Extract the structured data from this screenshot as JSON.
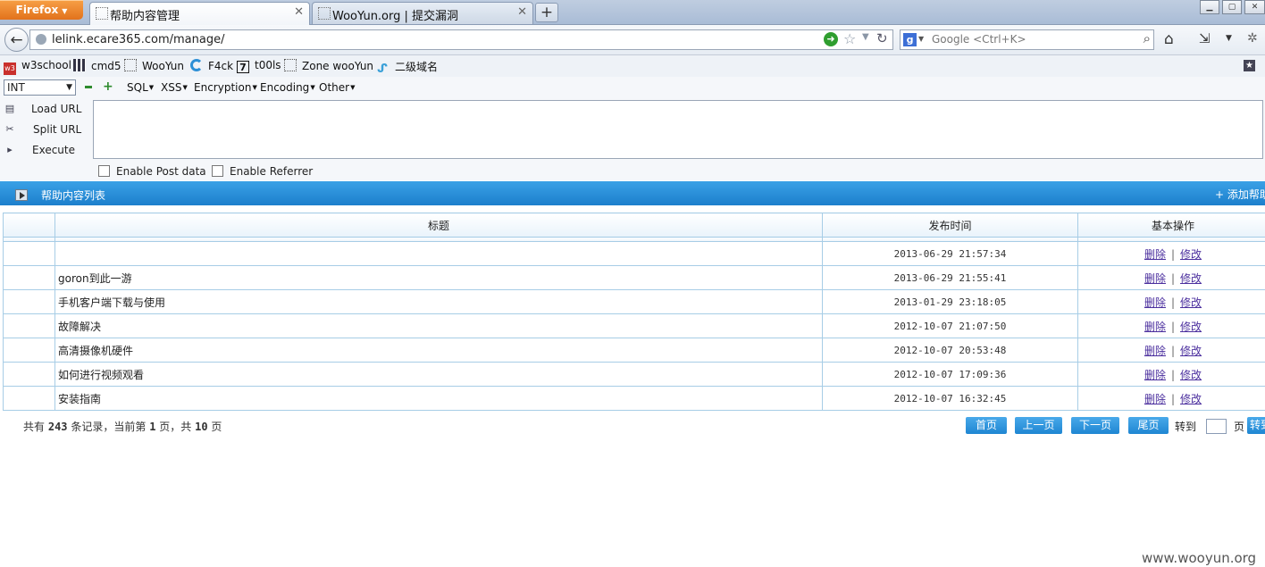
{
  "browser": {
    "menu_button": "Firefox",
    "tabs": [
      {
        "title": "帮助内容管理",
        "close": "✕"
      },
      {
        "title": "WooYun.org | 提交漏洞",
        "close": "✕"
      }
    ],
    "new_tab": "+",
    "address": "lelink.ecare365.com/manage/",
    "search_placeholder": "Google <Ctrl+K>"
  },
  "bookmarks": [
    "w3school",
    "cmd5",
    "WooYun",
    "F4ck",
    "t00ls",
    "Zone wooYun",
    "二级域名"
  ],
  "hackbar": {
    "select_value": "INT",
    "menus": [
      "SQL",
      "XSS",
      "Encryption",
      "Encoding",
      "Other"
    ],
    "actions": [
      "Load URL",
      "Split URL",
      "Execute"
    ],
    "checkboxes": [
      "Enable Post data",
      "Enable Referrer"
    ]
  },
  "page": {
    "section_title": "帮助内容列表",
    "add_button": "添加帮助",
    "columns": [
      "标题",
      "发布时间",
      "基本操作"
    ],
    "rows": [
      {
        "title": "",
        "time": "2013-06-29 21:57:34"
      },
      {
        "title": "goron到此一游",
        "time": "2013-06-29 21:55:41"
      },
      {
        "title": "手机客户端下载与使用",
        "time": "2013-01-29 23:18:05"
      },
      {
        "title": "故障解决",
        "time": "2012-10-07 21:07:50"
      },
      {
        "title": "高清摄像机硬件",
        "time": "2012-10-07 20:53:48"
      },
      {
        "title": "如何进行视频观看",
        "time": "2012-10-07 17:09:36"
      },
      {
        "title": "安装指南",
        "time": "2012-10-07 16:32:45"
      }
    ],
    "delete_label": "删除",
    "edit_label": "修改",
    "op_separator": "|",
    "pagination": {
      "prefix": "共有",
      "total_records": "243",
      "records_mid": "条记录，当前第",
      "current_page": "1",
      "page_mid": "页，共",
      "total_pages": "10",
      "page_suffix": "页",
      "first": "首页",
      "prev": "上一页",
      "next": "下一页",
      "last": "尾页",
      "goto": "转到",
      "goto_unit": "页",
      "goto_button": "转到"
    }
  },
  "watermark": "www.wooyun.org"
}
